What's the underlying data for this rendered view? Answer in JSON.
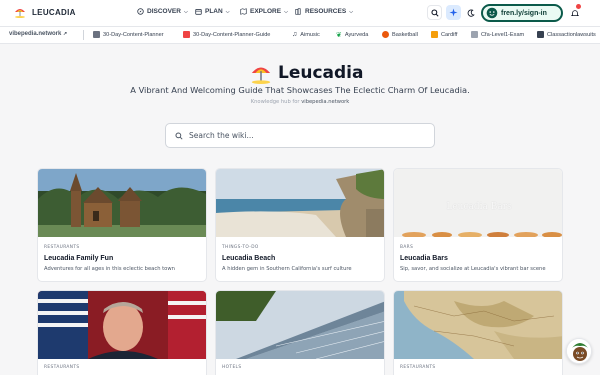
{
  "brand": {
    "name": "LEUCADIA"
  },
  "nav": [
    {
      "label": "DISCOVER"
    },
    {
      "label": "PLAN"
    },
    {
      "label": "EXPLORE"
    },
    {
      "label": "RESOURCES"
    }
  ],
  "signin": {
    "label": "fren.ly/sign-in"
  },
  "bookmarks": {
    "site": "vibepedia.network",
    "items": [
      {
        "label": "30-Day-Content-Planner",
        "color": "#6b7280"
      },
      {
        "label": "30-Day-Content-Planner-Guide",
        "color": "#ef4444"
      },
      {
        "label": "Aimusic",
        "color": "#111827"
      },
      {
        "label": "Ayurveda",
        "color": "#16a34a"
      },
      {
        "label": "Basketball",
        "color": "#ea580c"
      },
      {
        "label": "Cardiff",
        "color": "#f59e0b"
      },
      {
        "label": "Cfa-Level1-Exam",
        "color": "#6b7280"
      },
      {
        "label": "Classactionlawsuits",
        "color": "#374151"
      }
    ]
  },
  "hero": {
    "title": "Leucadia",
    "tagline": "A Vibrant And Welcoming Guide That Showcases The Eclectic Charm Of Leucadia.",
    "hub_prefix": "Knowledge hub for",
    "hub_site": "vibepedia.network"
  },
  "search": {
    "placeholder": "Search the wiki..."
  },
  "cards": [
    {
      "category": "RESTAURANTS",
      "title": "Leucadia Family Fun",
      "desc": "Adventures for all ages in this eclectic beach town"
    },
    {
      "category": "THINGS-TO-DO",
      "title": "Leucadia Beach",
      "desc": "A hidden gem in Southern California's surf culture"
    },
    {
      "category": "BARS",
      "title": "Leucadia Bars",
      "desc": "Sip, savor, and socialize at Leucadia's vibrant bar scene",
      "image_text": "Leucadia Bars"
    },
    {
      "category": "RESTAURANTS"
    },
    {
      "category": "HOTELS"
    },
    {
      "category": "RESTAURANTS"
    }
  ],
  "colors": {
    "accent": "#0b5a4a",
    "signin_bg": "#eafaf3",
    "badge": "#ef4444"
  }
}
